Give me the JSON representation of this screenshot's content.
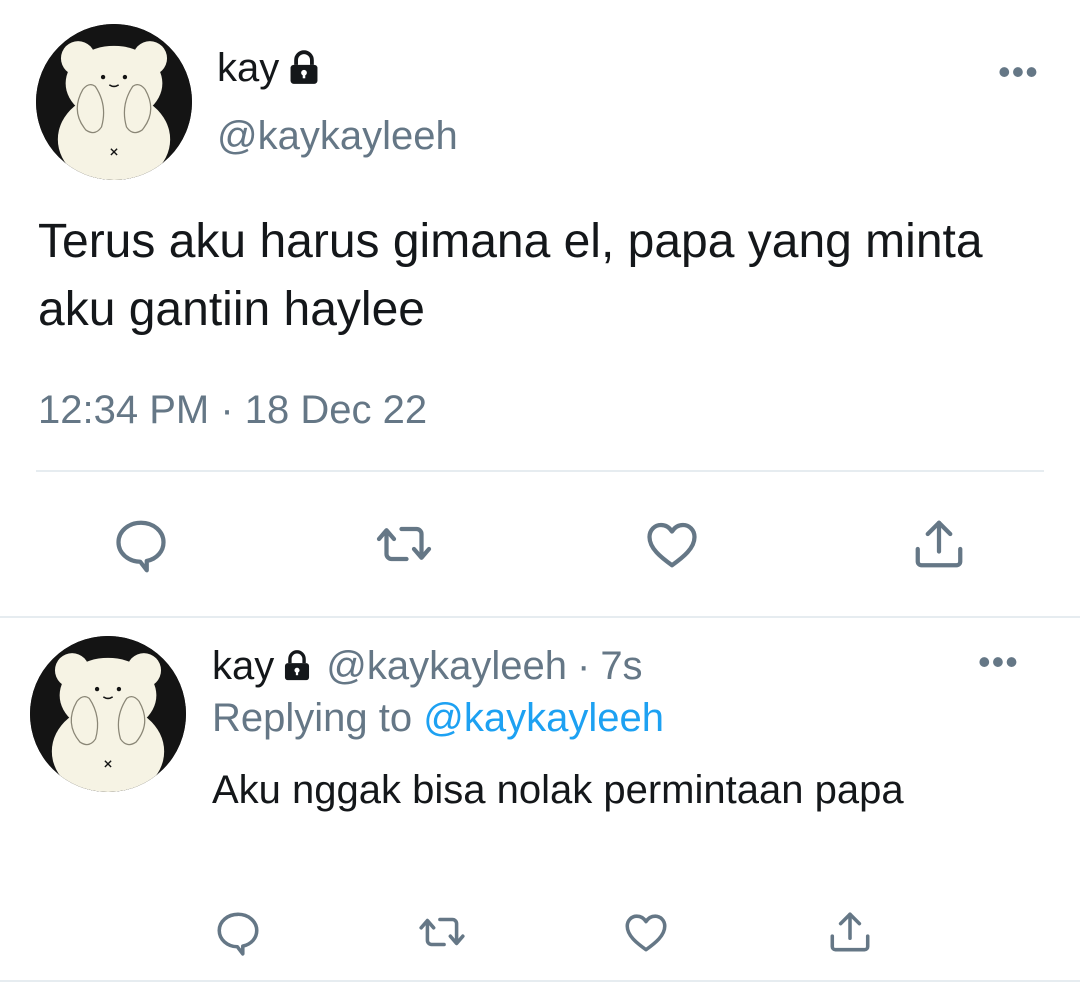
{
  "main_tweet": {
    "display_name": "kay",
    "handle": "@kaykayleeh",
    "text": "Terus aku harus gimana el, papa yang minta aku gantiin haylee",
    "time": "12:34 PM",
    "separator": "·",
    "date": "18 Dec 22",
    "more_icon": "more-dots-icon",
    "lock_icon": "lock-icon",
    "actions": [
      "reply-icon",
      "retweet-icon",
      "like-icon",
      "share-icon"
    ]
  },
  "reply_tweet": {
    "display_name": "kay",
    "handle": "@kaykayleeh",
    "separator": "·",
    "age": "7s",
    "replying_prefix": "Replying to",
    "replying_to": "@kaykayleeh",
    "text": "Aku nggak bisa nolak permintaan papa",
    "more_icon": "more-dots-icon",
    "lock_icon": "lock-icon",
    "actions": [
      "reply-icon",
      "retweet-icon",
      "like-icon",
      "share-icon"
    ]
  },
  "colors": {
    "text": "#14171a",
    "secondary": "#657786",
    "link": "#1da1f2",
    "divider": "#e6ecf0",
    "avatar_bg": "#141414",
    "bear": "#f6f3e4"
  }
}
